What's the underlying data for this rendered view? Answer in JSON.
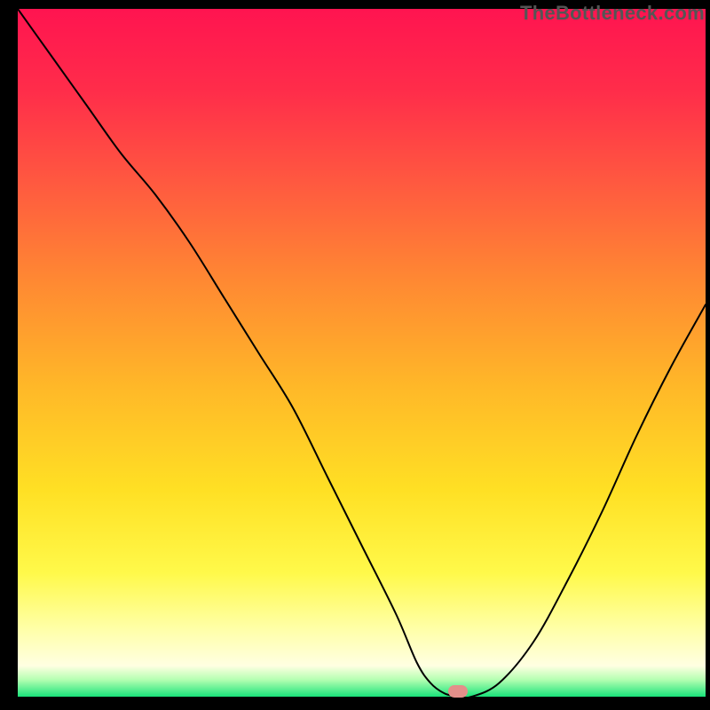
{
  "watermark": "TheBottleneck.com",
  "colors": {
    "gradient_top": "#ff1450",
    "gradient_mid": "#ffe024",
    "gradient_bottom": "#19e37a",
    "curve": "#000000",
    "marker": "#e38f8a",
    "frame": "#000000"
  },
  "chart_data": {
    "type": "line",
    "title": "",
    "xlabel": "",
    "ylabel": "",
    "xlim": [
      0,
      100
    ],
    "ylim": [
      0,
      100
    ],
    "x": [
      0,
      5,
      10,
      15,
      20,
      25,
      30,
      35,
      40,
      45,
      50,
      55,
      58,
      60,
      62,
      64,
      66,
      70,
      75,
      80,
      85,
      90,
      95,
      100
    ],
    "values": [
      100,
      93,
      86,
      79,
      73,
      66,
      58,
      50,
      42,
      32,
      22,
      12,
      5,
      2,
      0.5,
      0,
      0,
      2,
      8,
      17,
      27,
      38,
      48,
      57
    ],
    "flat_segment_x": [
      59,
      65
    ],
    "marker_x": 64,
    "marker_y": 0,
    "note": "Values are bottleneck percent read off vertically (0 at bottom green band, 100 at top). Curve descends steeply from top-left, flattens near x≈59–65 at y≈0, then rises toward upper-right."
  }
}
